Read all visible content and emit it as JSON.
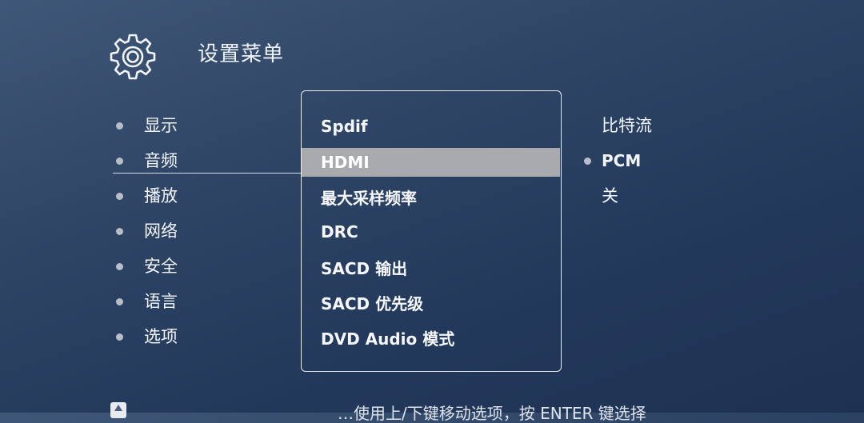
{
  "header": {
    "icon": "gear-icon",
    "title": "设置菜单"
  },
  "menu": {
    "items": [
      {
        "label": "显示"
      },
      {
        "label": "音频"
      },
      {
        "label": "播放"
      },
      {
        "label": "网络"
      },
      {
        "label": "安全"
      },
      {
        "label": "语言"
      },
      {
        "label": "选项"
      }
    ],
    "active": "音频"
  },
  "submenu": {
    "items": [
      {
        "label": "Spdif"
      },
      {
        "label": "HDMI"
      },
      {
        "label": "最大采样频率"
      },
      {
        "label": "DRC"
      },
      {
        "label": "SACD 输出"
      },
      {
        "label": "SACD 优先级"
      },
      {
        "label": "DVD Audio 模式"
      }
    ],
    "selected": "HDMI"
  },
  "options": {
    "items": [
      {
        "label": "比特流"
      },
      {
        "label": "PCM"
      },
      {
        "label": "关"
      }
    ],
    "current": "PCM"
  },
  "footer": {
    "icon": "up-arrow-icon",
    "hint": "…使用上/下键移动选项，按 ENTER 键选择"
  },
  "colors": {
    "background": "#2f4566",
    "selection": "#a8aaad",
    "text": "#f2f5f9"
  }
}
